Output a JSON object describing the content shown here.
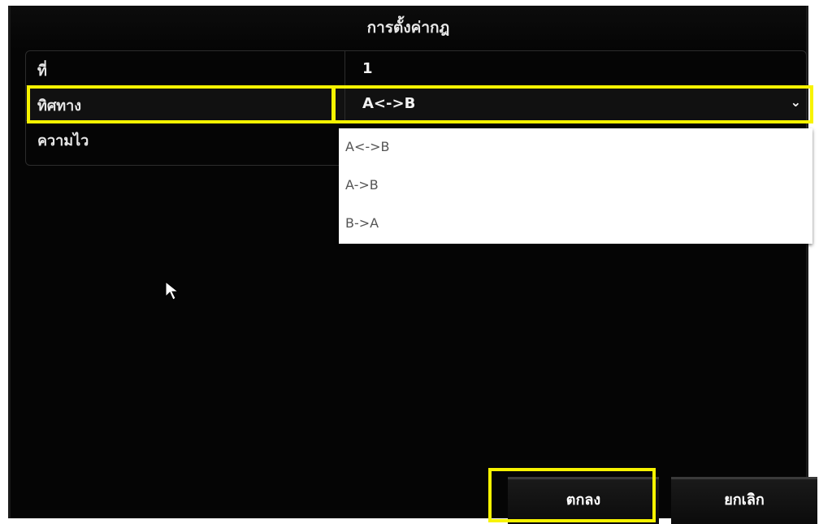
{
  "dialog": {
    "title": "การตั้งค่ากฎ"
  },
  "rows": [
    {
      "label": "ที่",
      "value": "1"
    },
    {
      "label": "ทิศทาง",
      "value": "A<->B"
    },
    {
      "label": "ความไว",
      "value": ""
    }
  ],
  "direction_dropdown": {
    "selected": "A<->B",
    "options": [
      "A<->B",
      "A->B",
      "B->A"
    ]
  },
  "buttons": {
    "ok_label": "ตกลง",
    "cancel_label": "ยกเลิก"
  },
  "colors": {
    "background": "#050505",
    "highlight": "#f7f300",
    "dropdown_bg": "#ffffff",
    "text": "#e6e6e6"
  },
  "icons": {
    "chevron": "chevron-down-icon",
    "cursor": "mouse-pointer-icon"
  }
}
